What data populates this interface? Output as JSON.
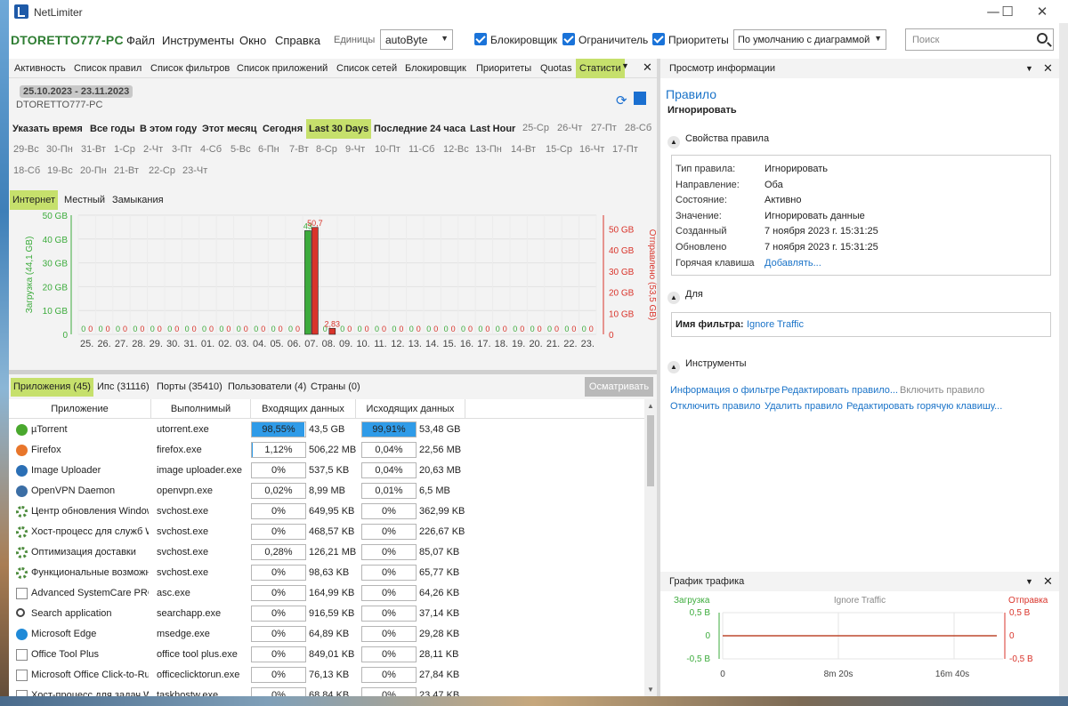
{
  "app": {
    "title": "NetLimiter",
    "hostname": "DTORETTO777-PC"
  },
  "window_controls": {
    "minimize": "—",
    "maximize": "☐",
    "close": "✕"
  },
  "menu": {
    "items": [
      "Файл",
      "Инструменты",
      "Окно",
      "Справка"
    ]
  },
  "toolbar": {
    "units_label": "Единицы",
    "units_value": "autoByte",
    "checkboxes": [
      {
        "label": "Блокировщик",
        "checked": true
      },
      {
        "label": "Ограничитель",
        "checked": true
      },
      {
        "label": "Приоритеты",
        "checked": true
      }
    ],
    "priority_value": "По умолчанию с диаграммой",
    "search_placeholder": "Поиск"
  },
  "left_tabs": {
    "items": [
      "Активность",
      "Список правил",
      "Список фильтров",
      "Список приложений",
      "Список сетей",
      "Блокировщик",
      "Приоритеты",
      "Quotas",
      "Статисти"
    ],
    "active_index": 8,
    "menu_icon": "▼",
    "close_icon": "✕"
  },
  "stats": {
    "date_range": "25.10.2023 - 23.11.2023",
    "pc_name": "DTORETTO777-PC",
    "refresh_icon": "⟳",
    "periods": [
      "Указать время",
      "Все годы",
      "В этом году",
      "Этот месяц",
      "Сегодня",
      "Last 30 Days",
      "Последние 24 часа",
      "Last Hour"
    ],
    "active_period": "Last 30 Days",
    "days_row1": [
      "25-Ср",
      "26-Чт",
      "27-Пт",
      "28-Сб"
    ],
    "days_row2": [
      "29-Вс",
      "30-Пн",
      "31-Вт",
      "1-Ср",
      "2-Чт",
      "3-Пт",
      "4-Сб",
      "5-Вс",
      "6-Пн",
      "7-Вт",
      "8-Ср",
      "9-Чт",
      "10-Пт",
      "11-Сб",
      "12-Вс",
      "13-Пн",
      "14-Вт",
      "15-Ср",
      "16-Чт",
      "17-Пт"
    ],
    "days_row3": [
      "18-Сб",
      "19-Вс",
      "20-Пн",
      "21-Вт",
      "22-Ср",
      "23-Чт"
    ],
    "sub_tabs": [
      "Интернет",
      "Местный",
      "Замыкания"
    ],
    "active_sub_tab": "Интернет"
  },
  "chart_data": {
    "type": "bar",
    "categories": [
      "25.",
      "26.",
      "27.",
      "28.",
      "29.",
      "30.",
      "31.",
      "01.",
      "02.",
      "03.",
      "04.",
      "05.",
      "06.",
      "07.",
      "08.",
      "09.",
      "10.",
      "11.",
      "12.",
      "13.",
      "14.",
      "15.",
      "16.",
      "17.",
      "18.",
      "19.",
      "20.",
      "21.",
      "22.",
      "23."
    ],
    "series": [
      {
        "name": "Загрузка",
        "color": "#3cab3c",
        "axis": "left",
        "values": [
          0,
          0,
          0,
          0,
          0,
          0,
          0,
          0,
          0,
          0,
          0,
          0,
          0,
          43.5,
          0,
          0,
          0,
          0,
          0,
          0,
          0,
          0,
          0,
          0,
          0,
          0,
          0,
          0,
          0,
          0
        ],
        "labels": [
          "0",
          "0",
          "0",
          "0",
          "0",
          "0",
          "0",
          "0",
          "0",
          "0",
          "0",
          "0",
          "0",
          "43",
          "0",
          "0",
          "0",
          "0",
          "0",
          "0",
          "0",
          "0",
          "0",
          "0",
          "0",
          "0",
          "0",
          "0",
          "0",
          "0"
        ]
      },
      {
        "name": "Отправлено",
        "color": "#d9342b",
        "axis": "right",
        "values": [
          0,
          0,
          0,
          0,
          0,
          0,
          0,
          0,
          0,
          0,
          0,
          0,
          0,
          50.7,
          2.83,
          0,
          0,
          0,
          0,
          0,
          0,
          0,
          0,
          0,
          0,
          0,
          0,
          0,
          0,
          0
        ],
        "labels": [
          "0",
          "0",
          "0",
          "0",
          "0",
          "0",
          "0",
          "0",
          "0",
          "0",
          "0",
          "0",
          "0",
          "50,7",
          "2,83",
          "0",
          "0",
          "0",
          "0",
          "0",
          "0",
          "0",
          "0",
          "0",
          "0",
          "0",
          "0",
          "0",
          "0",
          "0"
        ]
      }
    ],
    "left_axis": {
      "label": "Загрузка (44,1 GB)",
      "ticks": [
        "0",
        "10 GB",
        "20 GB",
        "30 GB",
        "40 GB",
        "50 GB"
      ],
      "max": 50
    },
    "right_axis": {
      "label": "Отправлено (53,5 GB)",
      "ticks": [
        "0",
        "10 GB",
        "20 GB",
        "30 GB",
        "40 GB",
        "50 GB"
      ],
      "max": 56.5
    },
    "grid": true
  },
  "list": {
    "tabs": [
      "Приложения (45)",
      "Ипс (31116)",
      "Порты (35410)",
      "Пользователи (4)",
      "Страны (0)"
    ],
    "active_tab": "Приложения (45)",
    "inspect_button": "Осматривать",
    "columns": [
      "Приложение",
      "Выполнимый",
      "Входящих данных",
      "Исходящих данных"
    ],
    "rows": [
      {
        "icon": "utorrent-icon",
        "color": "#4aa82e",
        "name": "µTorrent",
        "exe": "utorrent.exe",
        "in_pct": "98,55%",
        "in_fill": 0.9855,
        "in_val": "43,5 GB",
        "out_pct": "99,91%",
        "out_fill": 0.9991,
        "out_val": "53,48 GB"
      },
      {
        "icon": "firefox-icon",
        "color": "#e8762b",
        "name": "Firefox",
        "exe": "firefox.exe",
        "in_pct": "1,12%",
        "in_fill": 0.0112,
        "in_val": "506,22 MB",
        "out_pct": "0,04%",
        "out_fill": 0,
        "out_val": "22,56 MB"
      },
      {
        "icon": "image-uploader-icon",
        "color": "#2b6fb5",
        "name": "Image Uploader",
        "exe": "image uploader.exe",
        "in_pct": "0%",
        "in_fill": 0,
        "in_val": "537,5 KB",
        "out_pct": "0,04%",
        "out_fill": 0,
        "out_val": "20,63 MB"
      },
      {
        "icon": "openvpn-icon",
        "color": "#3b6ea5",
        "name": "OpenVPN Daemon",
        "exe": "openvpn.exe",
        "in_pct": "0,02%",
        "in_fill": 0,
        "in_val": "8,99 MB",
        "out_pct": "0,01%",
        "out_fill": 0,
        "out_val": "6,5 MB"
      },
      {
        "icon": "gear-icon",
        "color": "#4a8a3a",
        "name": "Центр обновления Windows",
        "exe": "svchost.exe",
        "in_pct": "0%",
        "in_fill": 0,
        "in_val": "649,95 KB",
        "out_pct": "0%",
        "out_fill": 0,
        "out_val": "362,99 KB"
      },
      {
        "icon": "gear-icon",
        "color": "#4a8a3a",
        "name": "Хост-процесс для служб Windows",
        "exe": "svchost.exe",
        "in_pct": "0%",
        "in_fill": 0,
        "in_val": "468,57 KB",
        "out_pct": "0%",
        "out_fill": 0,
        "out_val": "226,67 KB"
      },
      {
        "icon": "gear-icon",
        "color": "#4a8a3a",
        "name": "Оптимизация доставки",
        "exe": "svchost.exe",
        "in_pct": "0,28%",
        "in_fill": 0,
        "in_val": "126,21 MB",
        "out_pct": "0%",
        "out_fill": 0,
        "out_val": "85,07 KB"
      },
      {
        "icon": "gear-icon",
        "color": "#4a8a3a",
        "name": "Функциональные возможности",
        "exe": "svchost.exe",
        "in_pct": "0%",
        "in_fill": 0,
        "in_val": "98,63 KB",
        "out_pct": "0%",
        "out_fill": 0,
        "out_val": "65,77 KB"
      },
      {
        "icon": "file-icon",
        "color": "#ffffff",
        "name": "Advanced SystemCare PRO",
        "exe": "asc.exe",
        "in_pct": "0%",
        "in_fill": 0,
        "in_val": "164,99 KB",
        "out_pct": "0%",
        "out_fill": 0,
        "out_val": "64,26 KB"
      },
      {
        "icon": "search-icon",
        "color": "#444444",
        "name": "Search application",
        "exe": "searchapp.exe",
        "in_pct": "0%",
        "in_fill": 0,
        "in_val": "916,59 KB",
        "out_pct": "0%",
        "out_fill": 0,
        "out_val": "37,14 KB"
      },
      {
        "icon": "edge-icon",
        "color": "#1f8ad8",
        "name": "Microsoft Edge",
        "exe": "msedge.exe",
        "in_pct": "0%",
        "in_fill": 0,
        "in_val": "64,89 KB",
        "out_pct": "0%",
        "out_fill": 0,
        "out_val": "29,28 KB"
      },
      {
        "icon": "file-icon",
        "color": "#ffffff",
        "name": "Office Tool Plus",
        "exe": "office tool plus.exe",
        "in_pct": "0%",
        "in_fill": 0,
        "in_val": "849,01 KB",
        "out_pct": "0%",
        "out_fill": 0,
        "out_val": "28,11 KB"
      },
      {
        "icon": "file-icon",
        "color": "#ffffff",
        "name": "Microsoft Office Click-to-Run",
        "exe": "officeclicktorun.exe",
        "in_pct": "0%",
        "in_fill": 0,
        "in_val": "76,13 KB",
        "out_pct": "0%",
        "out_fill": 0,
        "out_val": "27,84 KB"
      },
      {
        "icon": "file-icon",
        "color": "#ffffff",
        "name": "Хост-процесс для задач Windows",
        "exe": "taskhostw.exe",
        "in_pct": "0%",
        "in_fill": 0,
        "in_val": "68,84 KB",
        "out_pct": "0%",
        "out_fill": 0,
        "out_val": "23,47 KB"
      }
    ]
  },
  "info_panel": {
    "header": "Просмотр информации",
    "title": "Правило",
    "action": "Игнорировать",
    "properties_section": "Свойства правила",
    "properties": [
      {
        "label": "Тип правила:",
        "value": "Игнорировать"
      },
      {
        "label": "Направление:",
        "value": "Оба"
      },
      {
        "label": "Состояние:",
        "value": "Активно"
      },
      {
        "label": "Значение:",
        "value": "Игнорировать данные"
      },
      {
        "label": "Созданный",
        "value": "7 ноября 2023 г. 15:31:25"
      },
      {
        "label": "Обновлено",
        "value": "7 ноября 2023 г. 15:31:25"
      },
      {
        "label": "Горячая клавиша",
        "value": "Добавлять..."
      }
    ],
    "for_section": "Для",
    "filter_label": "Имя фильтра:",
    "filter_value": "Ignore Traffic",
    "tools_section": "Инструменты",
    "tools": [
      "Информация о фильтре",
      "Редактировать правило...",
      "Включить правило",
      "Отключить правило",
      "Удалить правило",
      "Редактировать горячую клавишу..."
    ]
  },
  "traffic_graph": {
    "header": "График трафика",
    "left_label": "Загрузка",
    "right_label": "Отправка",
    "center_label": "Ignore Traffic",
    "left_ticks": [
      "0,5 B",
      "0",
      "-0,5 B"
    ],
    "right_ticks": [
      "0,5 B",
      "0",
      "-0,5 B"
    ],
    "x_ticks": [
      "0",
      "8m 20s",
      "16m 40s"
    ]
  }
}
